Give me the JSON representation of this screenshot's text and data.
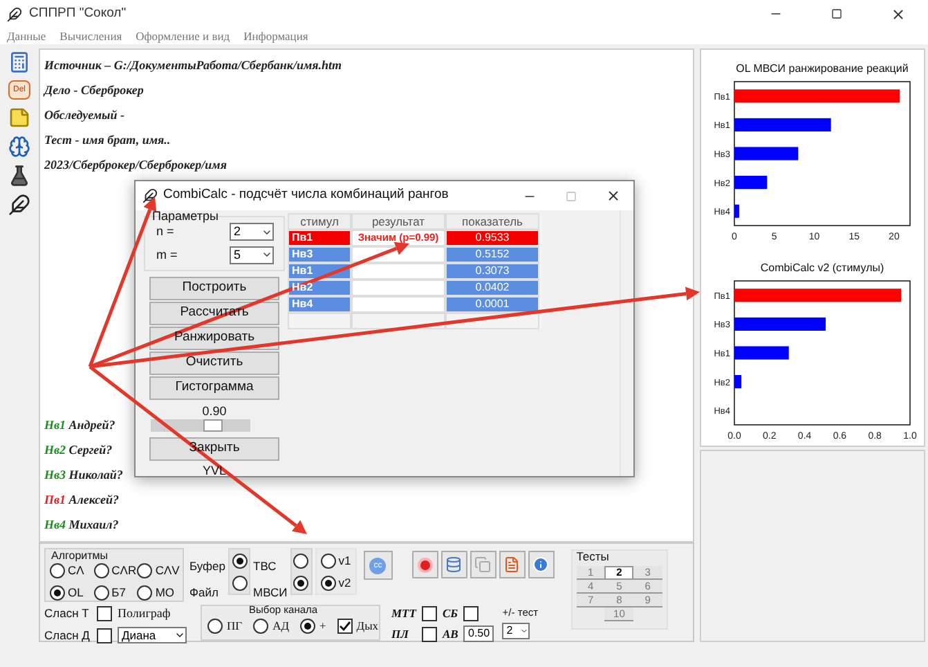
{
  "window": {
    "title": "СППРП \"Сокол\""
  },
  "menu": [
    "Данные",
    "Вычисления",
    "Оформление и вид",
    "Информация"
  ],
  "sidebar": {
    "items": [
      {
        "kind": "calculator"
      },
      {
        "kind": "delete",
        "label": "Del"
      },
      {
        "kind": "note"
      },
      {
        "kind": "head"
      },
      {
        "kind": "flask"
      },
      {
        "kind": "logo"
      }
    ]
  },
  "document": {
    "lines": [
      "Источник – G:/ДокументыРабота/Сбербанк/имя.htm",
      "Дело - Сберброкер",
      "Обследуемый -",
      "Тест - имя брат, имя..",
      "2023/Сберброкер/Сберброкер/имя"
    ],
    "answers": [
      {
        "code": "Нв1",
        "name": "Андрей?",
        "color": "#1e8c1e"
      },
      {
        "code": "Нв2",
        "name": "Сергей?",
        "color": "#1e8c1e"
      },
      {
        "code": "Нв3",
        "name": "Николай?",
        "color": "#1e8c1e"
      },
      {
        "code": "Пв1",
        "name": "Алексей?",
        "color": "#e02020"
      },
      {
        "code": "Нв4",
        "name": "Михаил?",
        "color": "#1e8c1e"
      }
    ]
  },
  "charts_panel": {
    "charts": [
      {
        "chart_data": {
          "type": "bar",
          "orientation": "horizontal",
          "title": "OL МВСИ ранжирование реакций",
          "categories": [
            "Пв1",
            "Нв1",
            "Нв3",
            "Нв2",
            "Нв4"
          ],
          "xlim": [
            0,
            22
          ],
          "xticks": [
            0,
            5,
            10,
            15,
            20
          ],
          "series": [
            {
              "color": "#ff0000",
              "values": [
                20.7,
                null,
                null,
                null,
                null
              ]
            },
            {
              "color": "#0000ff",
              "values": [
                null,
                12.1,
                8,
                4.1,
                0.6
              ]
            }
          ]
        }
      },
      {
        "chart_data": {
          "type": "bar",
          "orientation": "horizontal",
          "title": "CombiCalc v2 (стимулы)",
          "categories": [
            "Пв1",
            "Нв3",
            "Нв1",
            "Нв2",
            "Нв4"
          ],
          "xlim": [
            0,
            1
          ],
          "xticks": [
            {
              "value": 0,
              "label": "0.0"
            },
            {
              "value": 0.2,
              "label": "0.2"
            },
            {
              "value": 0.4,
              "label": "0.4"
            },
            {
              "value": 0.6,
              "label": "0.6"
            },
            {
              "value": 0.8,
              "label": "0.8"
            },
            {
              "value": 1,
              "label": "1.0"
            }
          ],
          "series": [
            {
              "color": "#ff0000",
              "values": [
                0.95,
                null,
                null,
                null,
                null
              ]
            },
            {
              "color": "#0000ff",
              "values": [
                null,
                0.52,
                0.31,
                0.04,
                0
              ]
            }
          ]
        }
      }
    ]
  },
  "dialog": {
    "title": "CombiCalc - подсчёт числа комбинаций рангов",
    "group": "Параметры",
    "params": [
      {
        "label": "n =",
        "value": "2"
      },
      {
        "label": "m =",
        "value": "5"
      }
    ],
    "buttons": [
      "Построить",
      "Рассчитать",
      "Ранжировать",
      "Очистить",
      "Гистограмма"
    ],
    "threshold": {
      "reading": "0.90",
      "level": 0.62
    },
    "close_button": "Закрыть",
    "footer": "YVL",
    "table": {
      "columns": [
        "стимул",
        "результат",
        "показатель"
      ],
      "rows": [
        {
          "stimulus": "Пв1",
          "result": "Значим (p=0.99)",
          "value": "0.9533",
          "significant": true
        },
        {
          "stimulus": "Нв3",
          "value": "0.5152",
          "significant": false
        },
        {
          "stimulus": "Нв1",
          "value": "0.3073",
          "significant": false
        },
        {
          "stimulus": "Нв2",
          "value": "0.0402",
          "significant": false
        },
        {
          "stimulus": "Нв4",
          "value": "0.0001",
          "significant": false
        }
      ]
    }
  },
  "toolbar": {
    "algorithms": {
      "title": "Алгоритмы",
      "options": [
        {
          "label": "CΛ",
          "selected": false
        },
        {
          "label": "CΛR",
          "selected": false
        },
        {
          "label": "CΛV",
          "selected": false
        },
        {
          "label": "OL",
          "selected": true
        },
        {
          "label": "Б7",
          "selected": false
        },
        {
          "label": "МО",
          "selected": false
        }
      ]
    },
    "source": [
      {
        "label": "Буфер",
        "selected": true
      },
      {
        "label": "Файл",
        "selected": false
      }
    ],
    "method": [
      {
        "label": "ТВС",
        "selected": false
      },
      {
        "label": "МВСИ",
        "selected": true
      }
    ],
    "version": [
      {
        "label": "v1",
        "selected": false
      },
      {
        "label": "v2",
        "selected": true
      }
    ],
    "cc_button": "cc",
    "options": [
      {
        "label": "Сласн Т",
        "checked": false
      },
      {
        "label": "Сласн Д",
        "checked": false
      }
    ],
    "polygraph": {
      "label": "Полиграф",
      "value": "Диана"
    },
    "channel": {
      "title": "Выбор канала",
      "options": [
        {
          "label": "ПГ",
          "selected": false
        },
        {
          "label": "АД",
          "selected": false
        },
        {
          "label": "+",
          "selected": true
        }
      ],
      "breath": {
        "label": "Дых",
        "checked": true
      }
    },
    "flags": [
      {
        "label": "МТТ",
        "checked": false
      },
      {
        "label": "СБ",
        "checked": false
      },
      {
        "label": "ПЛ",
        "checked": false
      }
    ],
    "ab": {
      "label": "АВ",
      "value": "0.50"
    },
    "test_shift": {
      "label": "+/- тест",
      "value": "2"
    },
    "tests": {
      "title": "Тесты",
      "items": [
        {
          "label": "1",
          "selected": false
        },
        {
          "label": "2",
          "selected": true
        },
        {
          "label": "3",
          "selected": false
        },
        {
          "label": "4",
          "selected": false
        },
        {
          "label": "5",
          "selected": false
        },
        {
          "label": "6",
          "selected": false
        },
        {
          "label": "7",
          "selected": false
        },
        {
          "label": "8",
          "selected": false
        },
        {
          "label": "9",
          "selected": false
        },
        {
          "label": "10",
          "selected": false
        }
      ]
    }
  }
}
